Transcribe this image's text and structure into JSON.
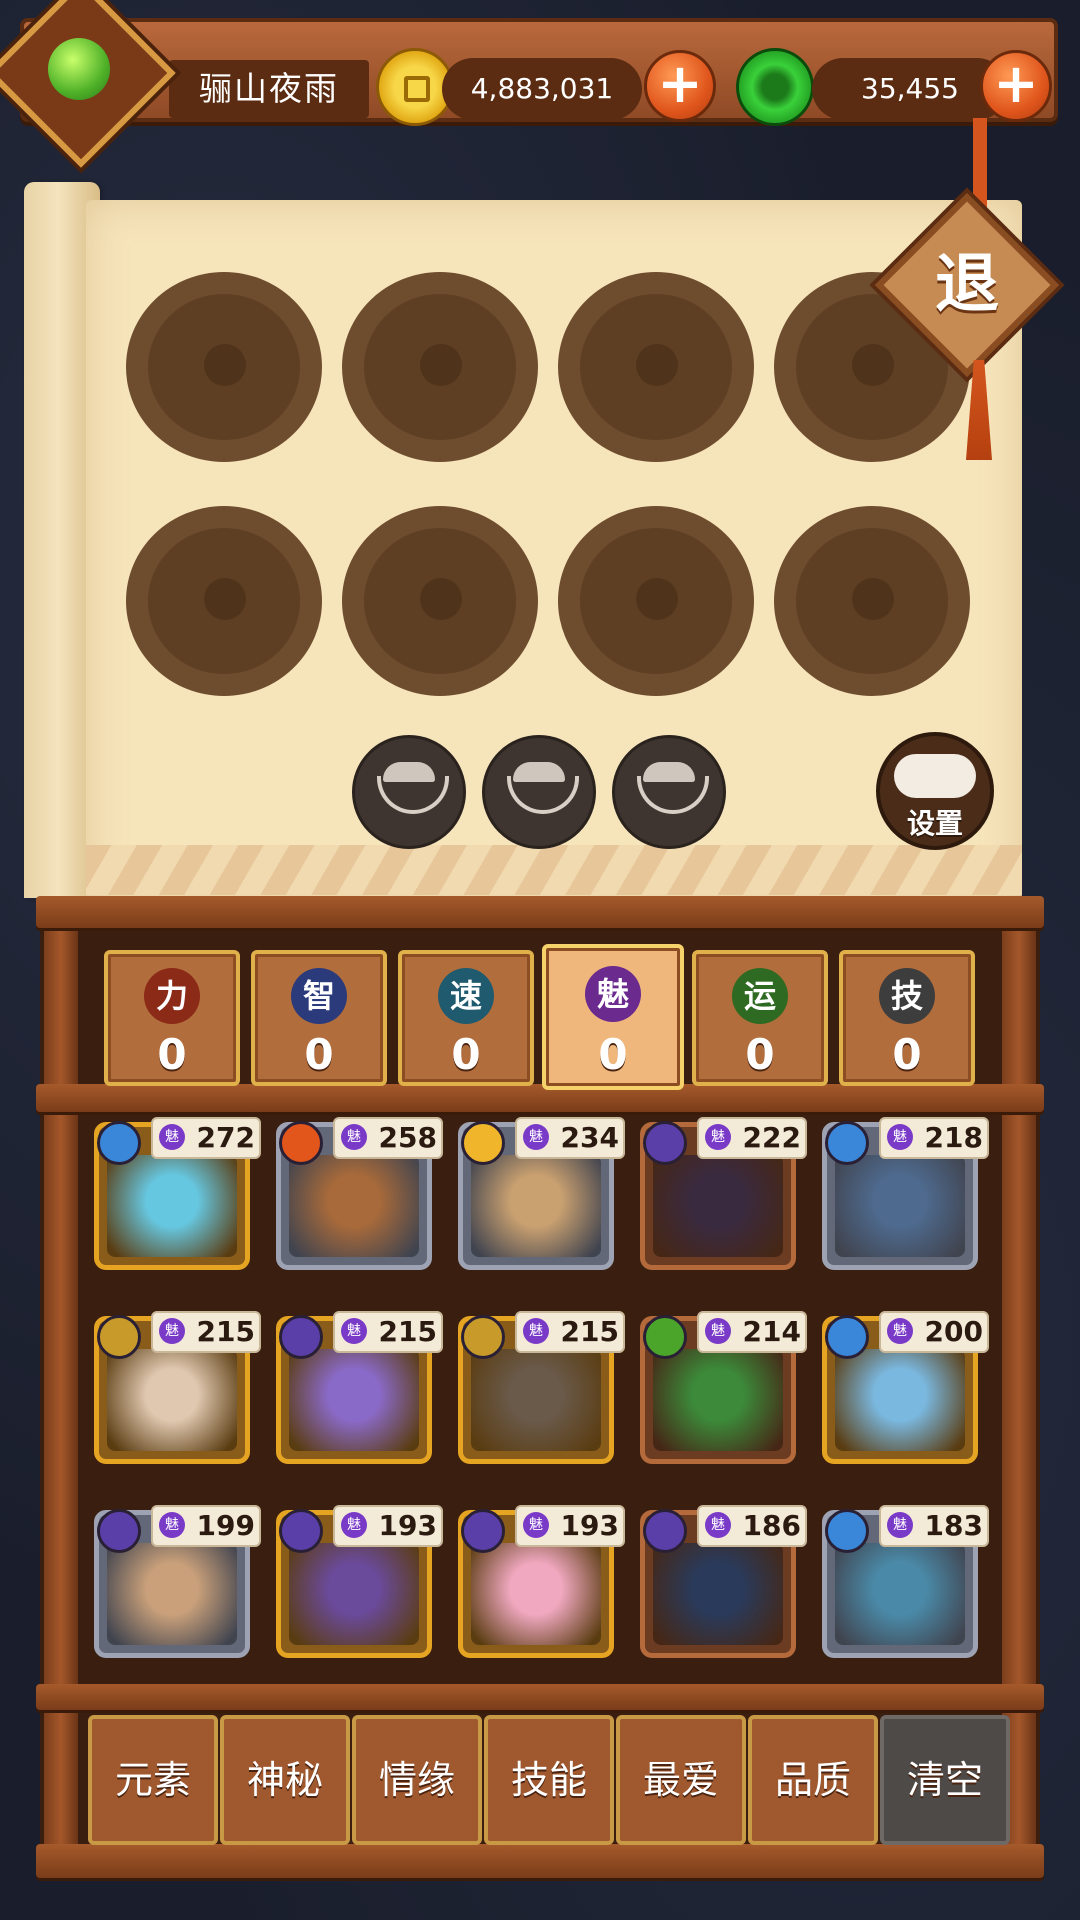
{
  "player": {
    "name": "骊山夜雨",
    "avatar_icon": "jade-dragon-icon"
  },
  "currency": {
    "coins": {
      "value": "4,883,031",
      "icon": "gold-coin-icon"
    },
    "jade": {
      "value": "35,455",
      "icon": "jade-coin-icon"
    },
    "add_icon": "plus-icon"
  },
  "exit_label": "退",
  "settings_label": "设置",
  "stats": [
    {
      "icon": "力",
      "value": "0",
      "color": "#8b2a16"
    },
    {
      "icon": "智",
      "value": "0",
      "color": "#2a3a7a"
    },
    {
      "icon": "速",
      "value": "0",
      "color": "#1f5a6e"
    },
    {
      "icon": "魅",
      "value": "0",
      "color": "#6a2a8e"
    },
    {
      "icon": "运",
      "value": "0",
      "color": "#2e6a22"
    },
    {
      "icon": "技",
      "value": "0",
      "color": "#3d3d3d"
    }
  ],
  "badge_icon": "魅",
  "heroes": [
    {
      "value": "272",
      "element": "water",
      "frame": "gold"
    },
    {
      "value": "258",
      "element": "fire",
      "frame": "silver"
    },
    {
      "value": "234",
      "element": "sun",
      "frame": "silver"
    },
    {
      "value": "222",
      "element": "moon",
      "frame": "bronze"
    },
    {
      "value": "218",
      "element": "water",
      "frame": "silver"
    },
    {
      "value": "215",
      "element": "earth",
      "frame": "gold"
    },
    {
      "value": "215",
      "element": "moon",
      "frame": "gold"
    },
    {
      "value": "215",
      "element": "earth",
      "frame": "gold"
    },
    {
      "value": "214",
      "element": "leaf",
      "frame": "bronze"
    },
    {
      "value": "200",
      "element": "water",
      "frame": "gold"
    },
    {
      "value": "199",
      "element": "moon",
      "frame": "silver"
    },
    {
      "value": "193",
      "element": "moon",
      "frame": "gold"
    },
    {
      "value": "193",
      "element": "moon",
      "frame": "gold"
    },
    {
      "value": "186",
      "element": "moon",
      "frame": "bronze"
    },
    {
      "value": "183",
      "element": "water",
      "frame": "silver"
    }
  ],
  "filters": [
    "元素",
    "神秘",
    "情缘",
    "技能",
    "最爱",
    "品质"
  ],
  "clear_label": "清空"
}
